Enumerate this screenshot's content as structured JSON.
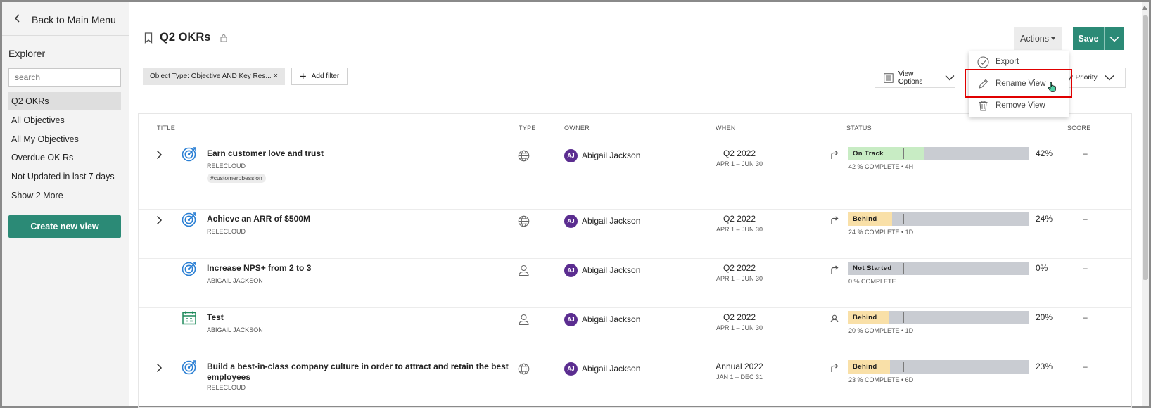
{
  "sidebar": {
    "back_label": "Back to Main Menu",
    "explorer_label": "Explorer",
    "search_placeholder": "search",
    "items": [
      {
        "label": "Q2 OKRs",
        "active": true
      },
      {
        "label": "All Objectives"
      },
      {
        "label": "All My Objectives"
      },
      {
        "label": "Overdue OK Rs"
      },
      {
        "label": "Not Updated in last 7 days"
      },
      {
        "label": "Show 2 More"
      }
    ],
    "create_label": "Create new view"
  },
  "header": {
    "title": "Q2 OKRs",
    "actions_label": "Actions",
    "save_label": "Save"
  },
  "filters": {
    "chip_label": "Object Type: Objective AND Key Res...",
    "chip_remove": "×",
    "add_filter_label": "Add filter",
    "view_options_label": "View Options",
    "sort_label": "y: Priority"
  },
  "actions_menu": {
    "items": [
      {
        "label": "Export",
        "icon": "check-circle-icon"
      },
      {
        "label": "Rename View",
        "icon": "pencil-icon",
        "highlighted": true
      },
      {
        "label": "Remove View",
        "icon": "trash-icon"
      }
    ]
  },
  "table": {
    "headers": {
      "title": "TITLE",
      "type": "TYPE",
      "owner": "OWNER",
      "when": "WHEN",
      "status": "STATUS",
      "score": "SCORE"
    },
    "rows": [
      {
        "title": "Earn customer love and trust",
        "subtitle": "RELECLOUD",
        "tag": "#customerobession",
        "type_icon": "globe-icon",
        "owner": "Abigail Jackson",
        "initials": "AJ",
        "when": "Q2 2022",
        "when_range": "APR 1 – JUN 30",
        "trend_icon": "arrow-turn-right-icon",
        "status": "On Track",
        "status_color": "#c8ecc4",
        "progress": 0.42,
        "percent": "42%",
        "complete": "42 % COMPLETE • 4H",
        "score": "–",
        "expandable": true,
        "object_icon": "target-icon"
      },
      {
        "title": "Achieve an ARR of $500M",
        "subtitle": "RELECLOUD",
        "type_icon": "globe-icon",
        "owner": "Abigail Jackson",
        "initials": "AJ",
        "when": "Q2 2022",
        "when_range": "APR 1 – JUN 30",
        "trend_icon": "arrow-turn-right-icon",
        "status": "Behind",
        "status_color": "#f9e0a8",
        "progress": 0.24,
        "percent": "24%",
        "complete": "24 % COMPLETE • 1D",
        "score": "–",
        "expandable": true,
        "object_icon": "target-icon"
      },
      {
        "title": "Increase NPS+ from 2 to 3",
        "subtitle": "ABIGAIL JACKSON",
        "type_icon": "person-icon",
        "owner": "Abigail Jackson",
        "initials": "AJ",
        "when": "Q2 2022",
        "when_range": "APR 1 – JUN 30",
        "trend_icon": "arrow-turn-right-icon",
        "status": "Not Started",
        "status_color": "#c9ccd2",
        "progress": 0.0,
        "percent": "0%",
        "complete": "0 % COMPLETE",
        "score": "–",
        "expandable": false,
        "object_icon": "target-icon"
      },
      {
        "title": "Test",
        "subtitle": "ABIGAIL JACKSON",
        "type_icon": "person-icon",
        "owner": "Abigail Jackson",
        "initials": "AJ",
        "when": "Q2 2022",
        "when_range": "APR 1 – JUN 30",
        "trend_icon": "person-small-icon",
        "status": "Behind",
        "status_color": "#f9e0a8",
        "progress": 0.2,
        "percent": "20%",
        "complete": "20 % COMPLETE • 1D",
        "score": "–",
        "expandable": false,
        "object_icon": "calendar-icon"
      },
      {
        "title": "Build a best-in-class company culture in order to attract and retain the best",
        "title_line2": "employees",
        "subtitle": "RELECLOUD",
        "type_icon": "globe-icon",
        "owner": "Abigail Jackson",
        "initials": "AJ",
        "when": "Annual 2022",
        "when_range": "JAN 1 – DEC 31",
        "trend_icon": "arrow-turn-right-icon",
        "status": "Behind",
        "status_color": "#f9e0a8",
        "progress": 0.23,
        "percent": "23%",
        "complete": "23 % COMPLETE • 6D",
        "score": "–",
        "expandable": true,
        "object_icon": "target-icon"
      }
    ]
  },
  "colors": {
    "accent": "#2b8a76",
    "avatar": "#5b2d90",
    "highlight": "#e00000",
    "icon_blue": "#2a7fd4",
    "icon_green": "#1f8a5b"
  }
}
